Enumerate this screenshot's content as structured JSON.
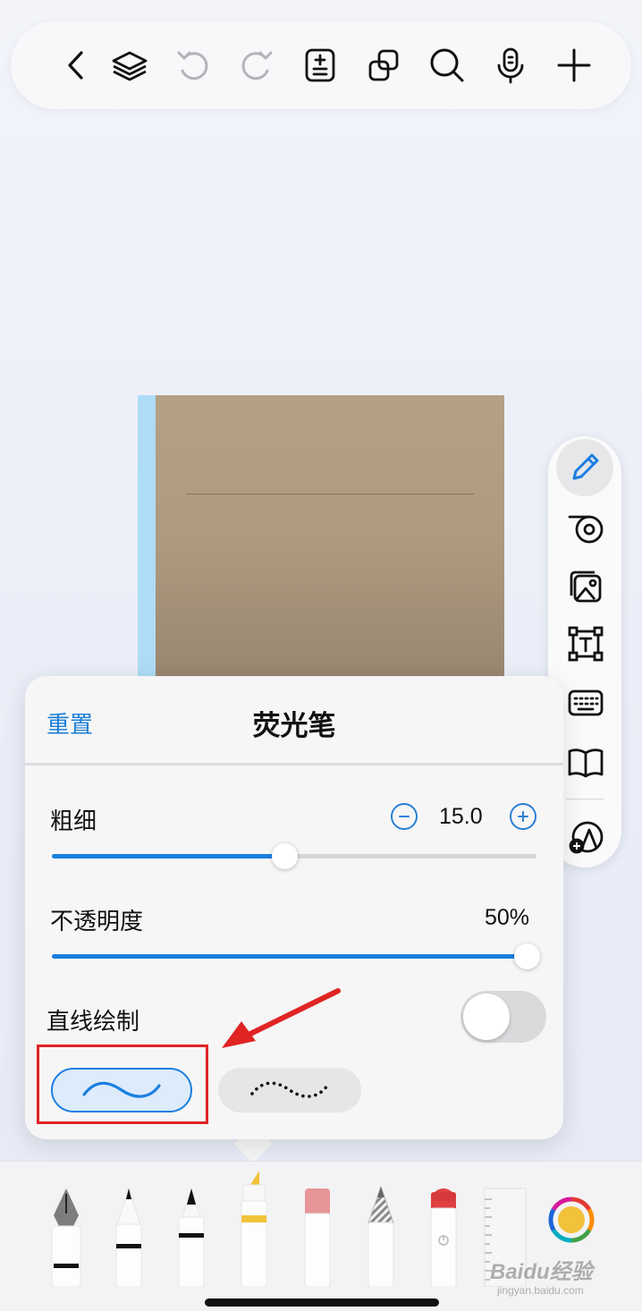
{
  "toolbar": {
    "icons": [
      "back-icon",
      "layers-icon",
      "undo-icon",
      "redo-icon",
      "page-add-icon",
      "copy-icon",
      "search-icon",
      "microphone-icon",
      "add-icon"
    ]
  },
  "side_toolbar": {
    "icons": [
      "pen-icon",
      "lasso-tape-icon",
      "image-icon",
      "text-box-icon",
      "keyboard-icon",
      "book-icon",
      "shapes-add-icon"
    ],
    "active": "pen-icon"
  },
  "settings": {
    "reset_label": "重置",
    "title": "荧光笔",
    "thickness": {
      "label": "粗细",
      "value": "15.0",
      "fraction": 0.48
    },
    "opacity": {
      "label": "不透明度",
      "value": "50%",
      "fraction": 0.98
    },
    "straight_line": {
      "label": "直线绘制",
      "enabled": false
    },
    "stroke_styles": [
      "smooth",
      "dotted"
    ],
    "selected_stroke": "smooth"
  },
  "pen_tray": {
    "tools": [
      "fountain-pen",
      "ballpoint-pen",
      "fine-pen",
      "highlighter",
      "eraser",
      "pencil",
      "lasso-tool",
      "ruler"
    ],
    "active_tool": "highlighter",
    "highlighter_color": "#f2c23a"
  },
  "colors": {
    "accent": "#1a7fe0",
    "annotation": "#e02424",
    "note_cover": "#ad9a7f",
    "note_spine": "#aedcf6"
  },
  "watermark": {
    "text": "Baidu经验",
    "sub": "jingyan.baidu.com"
  }
}
